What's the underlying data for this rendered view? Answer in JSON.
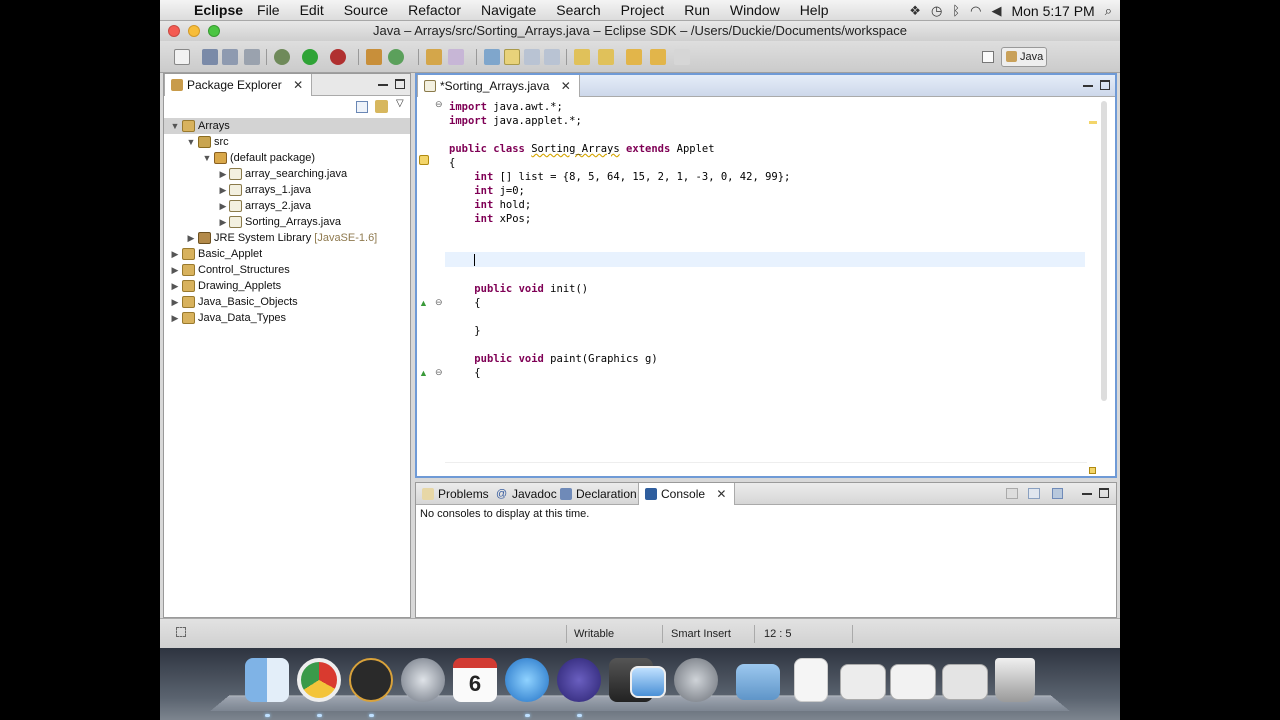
{
  "menubar": {
    "app": "Eclipse",
    "items": [
      "File",
      "Edit",
      "Source",
      "Refactor",
      "Navigate",
      "Search",
      "Project",
      "Run",
      "Window",
      "Help"
    ],
    "clock": "Mon 5:17 PM"
  },
  "window": {
    "title": "Java – Arrays/src/Sorting_Arrays.java – Eclipse SDK – /Users/Duckie/Documents/workspace"
  },
  "perspective": {
    "label": "Java"
  },
  "package_explorer": {
    "tab_label": "Package Explorer",
    "tree": [
      {
        "label": "Arrays",
        "kind": "project",
        "level": 0,
        "expanded": true,
        "selected": true
      },
      {
        "label": "src",
        "kind": "source-folder",
        "level": 1,
        "expanded": true
      },
      {
        "label": "(default package)",
        "kind": "package",
        "level": 2,
        "expanded": true
      },
      {
        "label": "array_searching.java",
        "kind": "java-file",
        "level": 3
      },
      {
        "label": "arrays_1.java",
        "kind": "java-file",
        "level": 3
      },
      {
        "label": "arrays_2.java",
        "kind": "java-file",
        "level": 3
      },
      {
        "label": "Sorting_Arrays.java",
        "kind": "java-file",
        "level": 3
      },
      {
        "label": "JRE System Library",
        "decoration": "[JavaSE-1.6]",
        "kind": "library",
        "level": 1
      },
      {
        "label": "Basic_Applet",
        "kind": "project",
        "level": 0
      },
      {
        "label": "Control_Structures",
        "kind": "project",
        "level": 0
      },
      {
        "label": "Drawing_Applets",
        "kind": "project",
        "level": 0
      },
      {
        "label": "Java_Basic_Objects",
        "kind": "project",
        "level": 0
      },
      {
        "label": "Java_Data_Types",
        "kind": "project",
        "level": 0
      }
    ]
  },
  "editor": {
    "tab_label": "*Sorting_Arrays.java",
    "lines": [
      "import java.awt.*;",
      "import java.applet.*;",
      "",
      "public class Sorting_Arrays extends Applet",
      "{",
      "    int [] list = {8, 5, 64, 15, 2, 1, -3, 0, 42, 99};",
      "    int j=0;",
      "    int hold;",
      "    int xPos;",
      "",
      "    ",
      "",
      "",
      "    public void init()",
      "    {",
      "",
      "    }",
      "",
      "    public void paint(Graphics g)",
      "    {"
    ]
  },
  "bottom_panel": {
    "tabs": [
      "Problems",
      "Javadoc",
      "Declaration",
      "Console"
    ],
    "active_tab": "Console",
    "message": "No consoles to display at this time."
  },
  "statusbar": {
    "mode": "Writable",
    "insert": "Smart Insert",
    "position": "12 : 5"
  },
  "dock": {
    "calendar_day": "6",
    "apps": [
      "finder-icon",
      "chrome-icon",
      "plex-icon",
      "launchpad-icon",
      "calendar-icon",
      "itunes-icon",
      "eclipse-icon",
      "imovie-icon",
      "preview-icon",
      "system-preferences-icon",
      "folder-icon",
      "document-icon",
      "window-thumbnail-icon",
      "window-thumbnail-icon",
      "window-thumbnail-icon",
      "trash-icon"
    ]
  },
  "colors": {
    "keyword": "#7f0055",
    "editor_border": "#6f9ad6",
    "current_line": "#e8f2fe"
  }
}
